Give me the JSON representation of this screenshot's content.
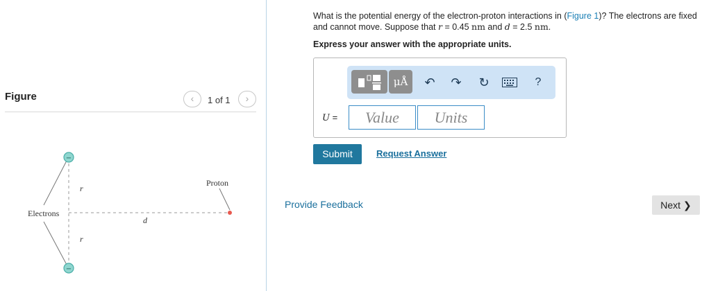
{
  "figure": {
    "title": "Figure",
    "pager": {
      "prev_icon": "chevron-left-icon",
      "count": "1 of 1",
      "next_icon": "chevron-right-icon"
    },
    "diagram": {
      "proton_label": "Proton",
      "electrons_label": "Electrons",
      "d_label": "d",
      "r_label_top": "r",
      "r_label_bottom": "r",
      "electron_charge": "−",
      "colors": {
        "electron": "#8fd6cf",
        "electron_outline": "#4aaea8",
        "proton": "#e8594f",
        "dash": "#999999"
      }
    }
  },
  "question": {
    "part1": "What is the potential energy of the electron-proton interactions in (",
    "figure_link": "Figure 1",
    "part2": ")? The electrons are fixed and cannot move. Suppose that ",
    "r_sym": "r",
    "part3": " = 0.45 ",
    "unit1": "nm",
    "part4": " and ",
    "d_sym": "d",
    "part5": " = 2.5 ",
    "unit2": "nm",
    "part6": ".",
    "instruction": "Express your answer with the appropriate units."
  },
  "answer": {
    "toolbar": {
      "units_label": "μÅ",
      "undo_icon": "undo-icon",
      "redo_icon": "redo-icon",
      "reset_icon": "reset-icon",
      "keyboard_icon": "keyboard-icon",
      "help_label": "?"
    },
    "u_symbol": "U",
    "u_equals": " =",
    "value_placeholder": "Value",
    "units_placeholder": "Units"
  },
  "actions": {
    "submit_label": "Submit",
    "request_answer_label": "Request Answer",
    "provide_feedback_label": "Provide Feedback",
    "next_label": "Next"
  },
  "colors": {
    "accent": "#20789e",
    "link": "#1a6f9c",
    "toolbar_bg": "#cfe3f6",
    "input_border": "#3a8cc7"
  }
}
